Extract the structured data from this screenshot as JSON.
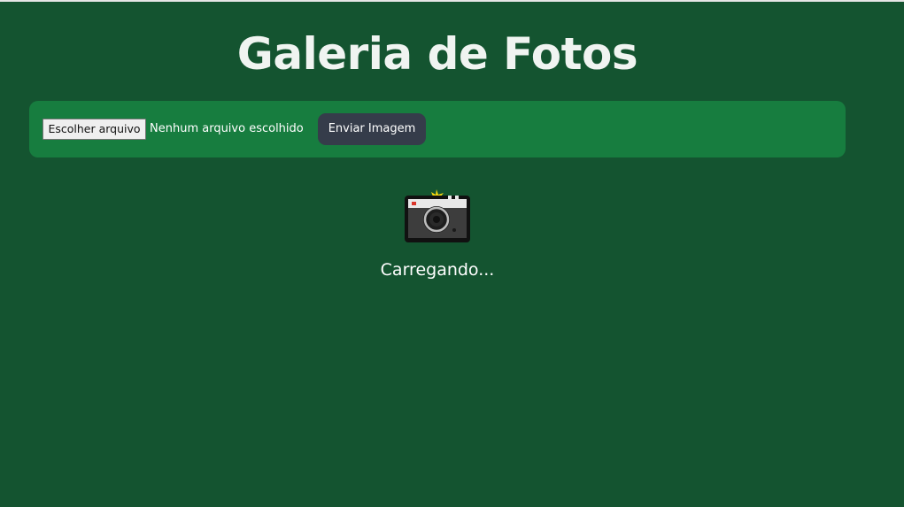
{
  "header": {
    "title": "Galeria de Fotos"
  },
  "upload": {
    "choose_file_label": "Escolher arquivo",
    "file_status": "Nenhum arquivo escolhido",
    "send_label": "Enviar Imagem"
  },
  "loading": {
    "icon": "camera-icon",
    "text": "Carregando..."
  },
  "colors": {
    "background": "#145430",
    "panel": "#177d3f",
    "button": "#353c4a",
    "title": "#f0f4f1"
  }
}
